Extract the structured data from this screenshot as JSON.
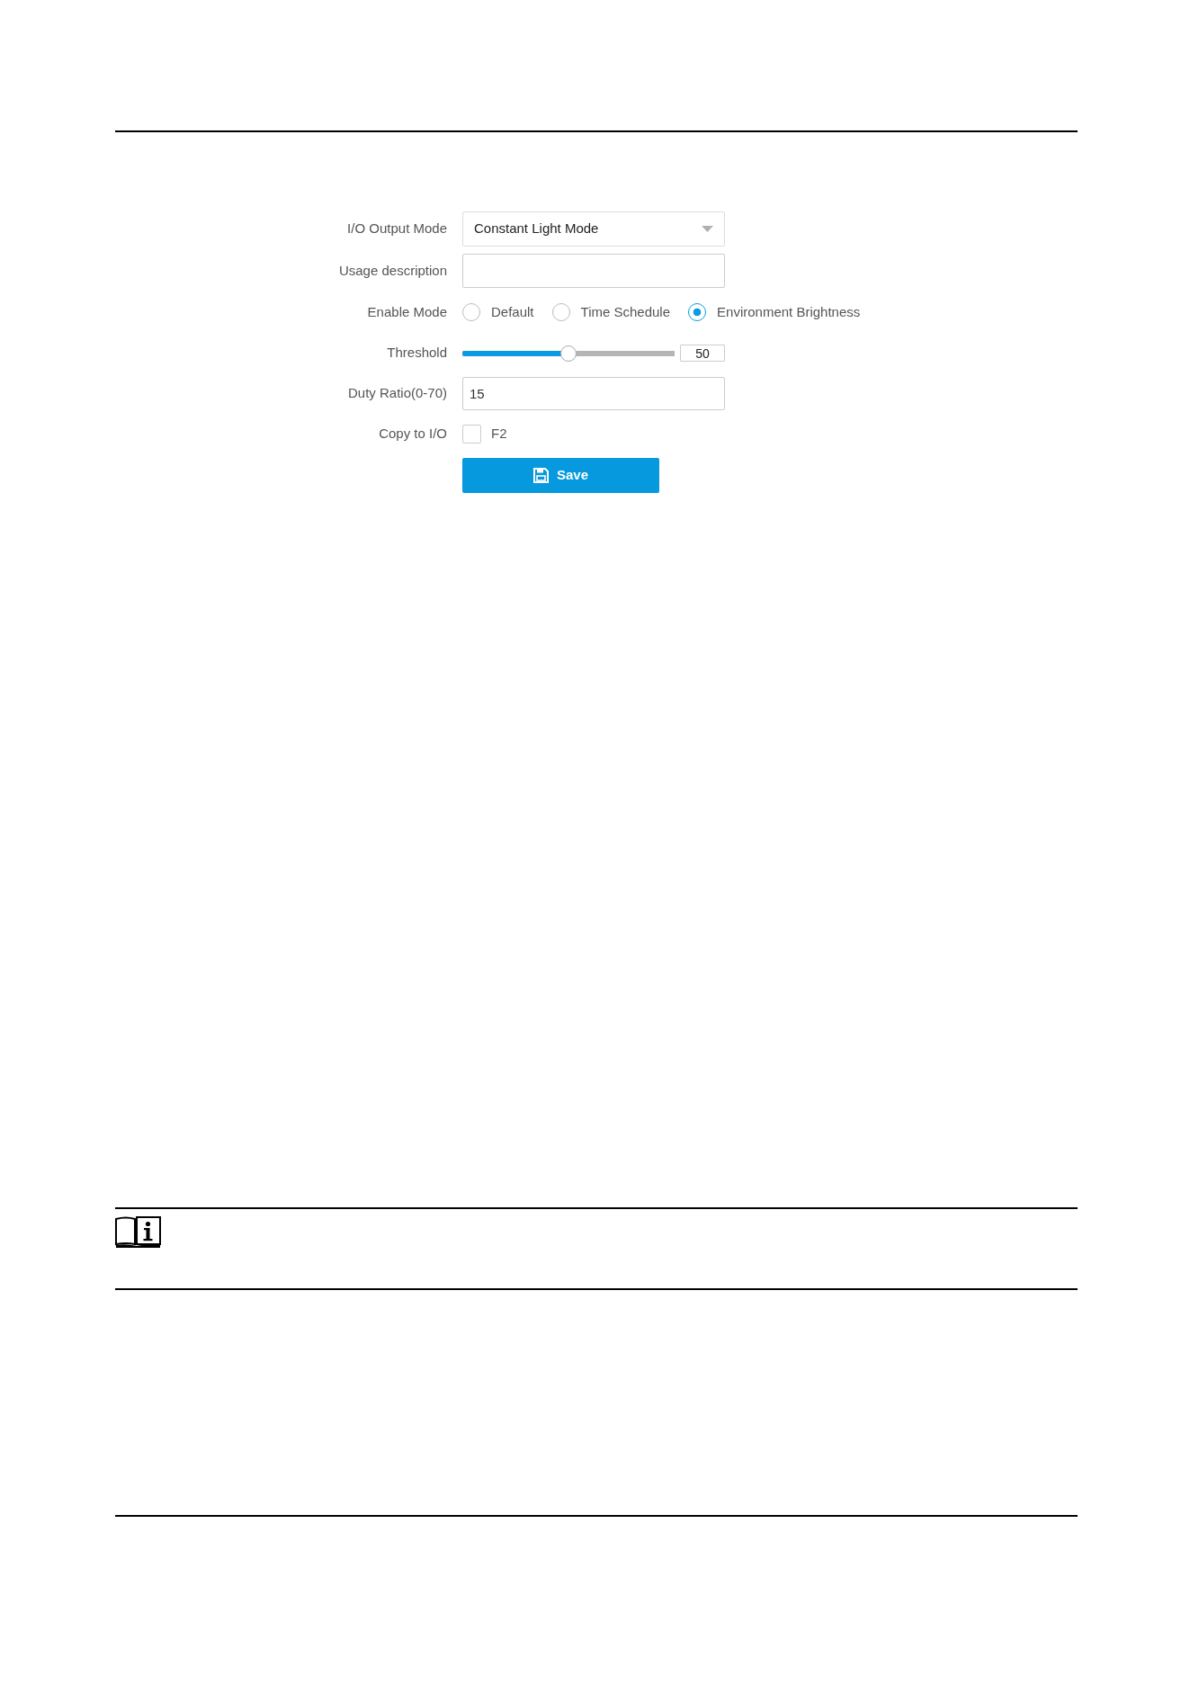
{
  "form": {
    "fields": [
      {
        "kind": "select",
        "label": "I/O Output Mode",
        "value": "Constant Light Mode"
      },
      {
        "kind": "text",
        "label": "Usage description"
      },
      {
        "kind": "radio",
        "label": "Enable Mode",
        "options": [
          {
            "label": "Default",
            "selected": false
          },
          {
            "label": "Time Schedule",
            "selected": false
          },
          {
            "label": "Environment Brightness",
            "selected": true
          }
        ]
      },
      {
        "kind": "slider",
        "label": "Threshold",
        "level": 0.5,
        "reading": "50"
      },
      {
        "kind": "text",
        "label": "Duty Ratio(0-70)",
        "value": "15"
      },
      {
        "kind": "checkbox",
        "label": "Copy to I/O",
        "options": [
          {
            "label": "F2",
            "checked": false
          }
        ]
      }
    ],
    "save_button": {
      "label": "Save"
    }
  }
}
